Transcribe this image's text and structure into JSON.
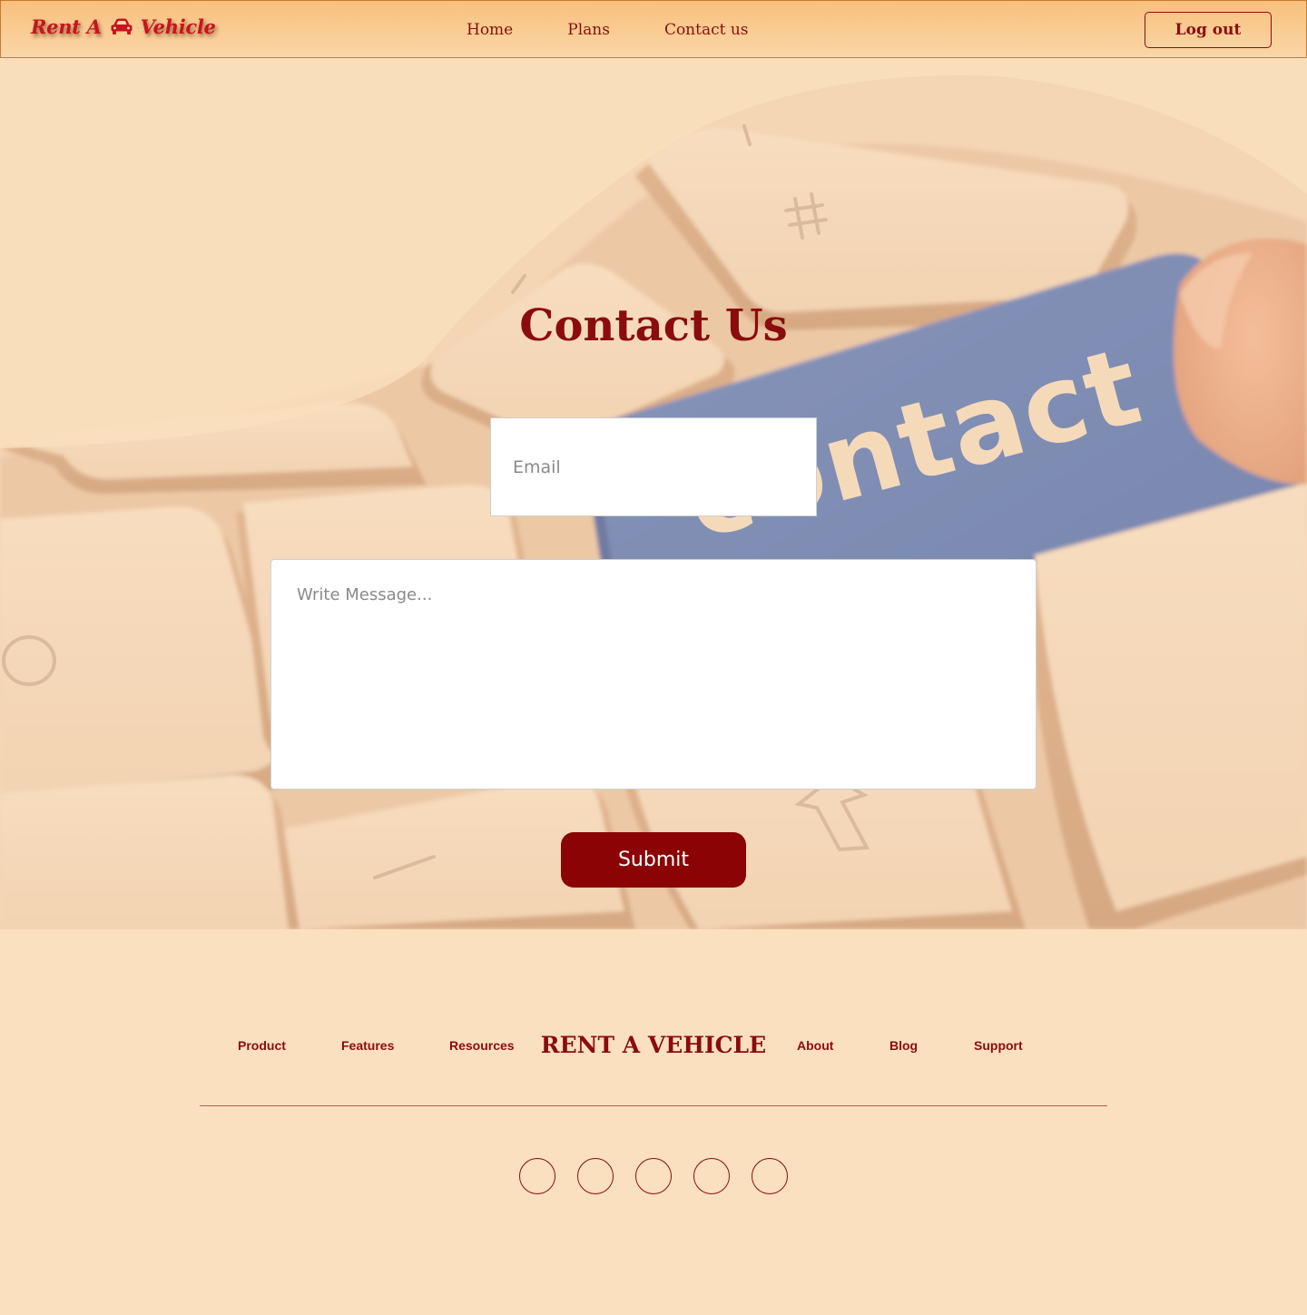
{
  "header": {
    "logo_left": "Rent A",
    "logo_right": "Vehicle",
    "logo_icon": "car-icon",
    "nav": [
      "Home",
      "Plans",
      "Contact us"
    ],
    "logout_label": "Log out"
  },
  "hero": {
    "title": "Contact Us",
    "background_image_word": "contact",
    "email_placeholder": "Email",
    "message_placeholder": "Write Message...",
    "submit_label": "Submit"
  },
  "footer": {
    "links_left": [
      "Product",
      "Features",
      "Resources"
    ],
    "brand": "RENT A VEHICLE",
    "links_right": [
      "About",
      "Blog",
      "Support"
    ],
    "social_icons": [
      "social-icon-1",
      "social-icon-2",
      "social-icon-3",
      "social-icon-4",
      "social-icon-5"
    ]
  },
  "colors": {
    "page_bg": "#fbe0bf",
    "brand_red": "#8b0c0c",
    "logo_red": "#c8141c",
    "button_red": "#8b0305",
    "header_top": "#f8c07c",
    "contact_key_blue": "#4f6db0"
  }
}
